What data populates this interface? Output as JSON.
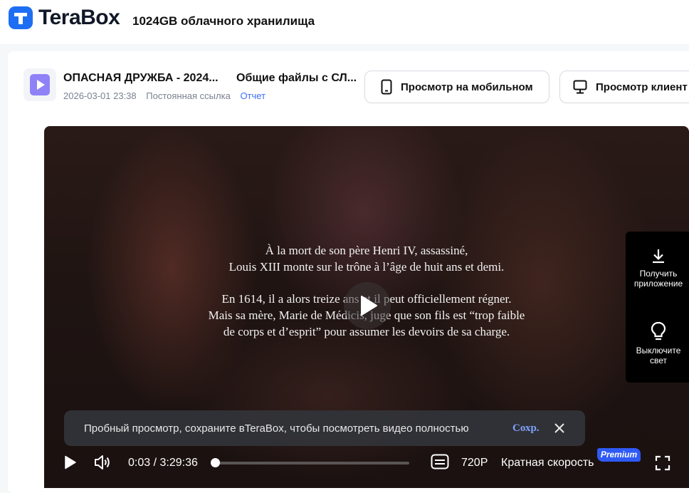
{
  "header": {
    "logo_text": "TeraBox",
    "tagline": "1024GB облачного хранилища"
  },
  "file": {
    "name": "ОПАСНАЯ ДРУЖБА - 2024...",
    "folder": "Общие файлы с СЛ...",
    "date": "2026-03-01 23:38",
    "permalink_label": "Постоянная ссылка",
    "report_label": "Отчет"
  },
  "buttons": {
    "mobile_label": "Просмотр на мобильном",
    "client_label": "Просмотр клиент"
  },
  "player": {
    "subtitles": [
      "À la mort de son père Henri IV, assassiné,",
      "Louis XIII monte sur le trône à l’âge de huit ans et demi.",
      "En 1614, il a alors treize ans et il peut officiellement régner.",
      "Mais sa mère, Marie de Médicis, juge que son fils est “trop faible",
      "de corps et d’esprit” pour assumer les devoirs de sa charge."
    ],
    "side_panel": {
      "get_app_label": "Получить приложение",
      "lights_off_label": "Выключите свет"
    },
    "notice": {
      "text": "Пробный просмотр, сохраните вTeraBox, чтобы посмотреть видео полностью",
      "save_label": "Сохр."
    },
    "controls": {
      "time": "0:03 / 3:29:36",
      "progress": 0.0002,
      "quality": "720P",
      "speed_label": "Кратная скорость",
      "premium_badge": "Premium"
    }
  },
  "colors": {
    "brand_blue": "#1e6ef4",
    "link_blue": "#3a6ff7",
    "premium_blue": "#2f5af5",
    "file_icon_purple": "#8f82f7"
  }
}
